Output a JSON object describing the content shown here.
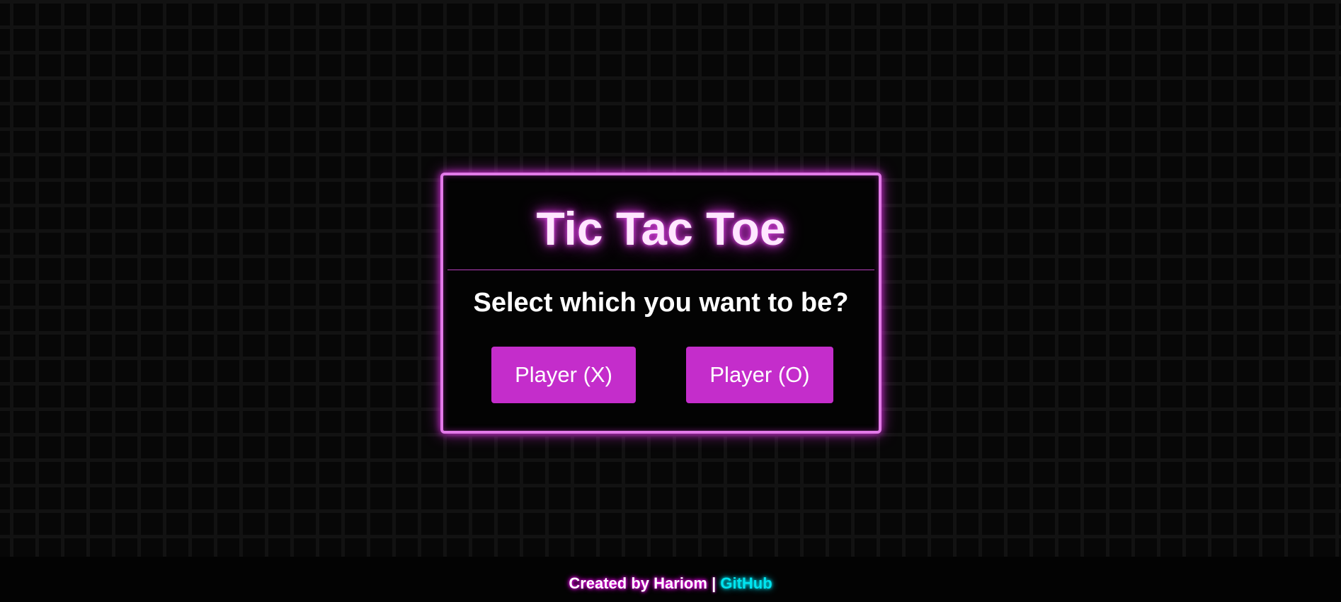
{
  "game": {
    "title": "Tic Tac Toe",
    "prompt": "Select which you want to be?",
    "player_x_label": "Player (X)",
    "player_o_label": "Player (O)"
  },
  "footer": {
    "created_by": "Created by Hariom",
    "separator": "|",
    "link_label": "GitHub"
  },
  "colors": {
    "accent": "#c42dcb",
    "border_glow": "#e27ae8",
    "link": "#00e5f0",
    "background": "#050505"
  }
}
